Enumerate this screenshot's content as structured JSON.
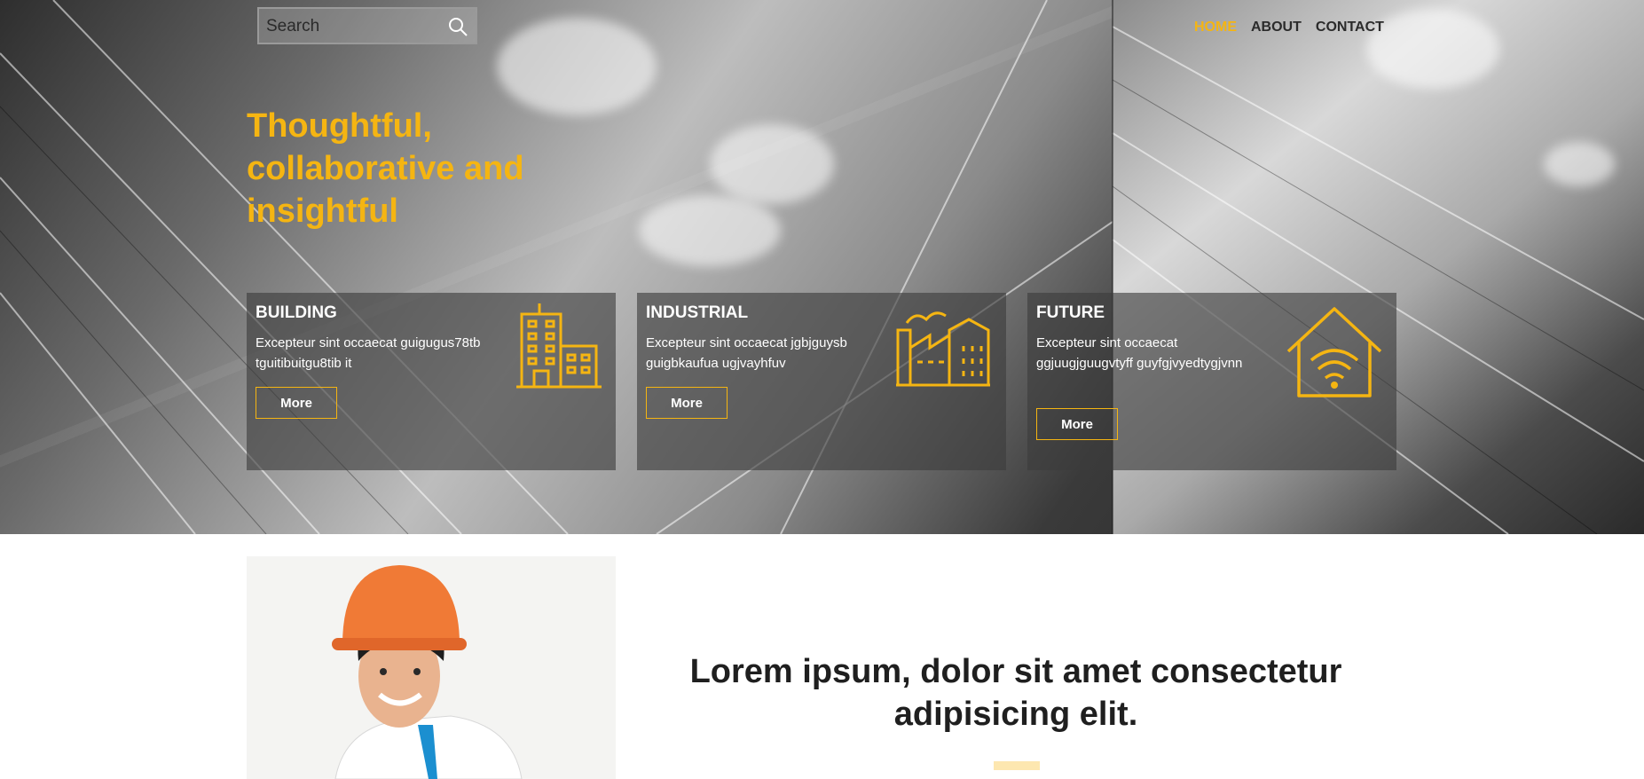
{
  "search": {
    "placeholder": "Search",
    "icon": "search-icon"
  },
  "nav": {
    "items": [
      "HOME",
      "ABOUT",
      "CONTACT"
    ],
    "active": "HOME"
  },
  "hero": {
    "headline": "Thoughtful, collaborative and insightful"
  },
  "cards": [
    {
      "title": "BUILDING",
      "desc": "Excepteur sint occaecat guigugus78tb tguitibuitgu8tib it",
      "button": "More",
      "icon": "building-icon"
    },
    {
      "title": "INDUSTRIAL",
      "desc": "Excepteur sint occaecat jgbjguysb guigbkaufua ugjvayhfuv",
      "button": "More",
      "icon": "factory-icon"
    },
    {
      "title": "FUTURE",
      "desc": "Excepteur sint occaecat ggjuugjguugvtyff guyfgjvyedtygjvnn",
      "button": "More",
      "icon": "smart-home-wifi-icon"
    }
  ],
  "about": {
    "heading": "Lorem ipsum, dolor sit amet consectetur adipisicing elit."
  },
  "colors": {
    "accent": "#f5b512",
    "card_bg": "rgba(60,60,60,0.62)",
    "text_dark": "#1f1f1f"
  }
}
